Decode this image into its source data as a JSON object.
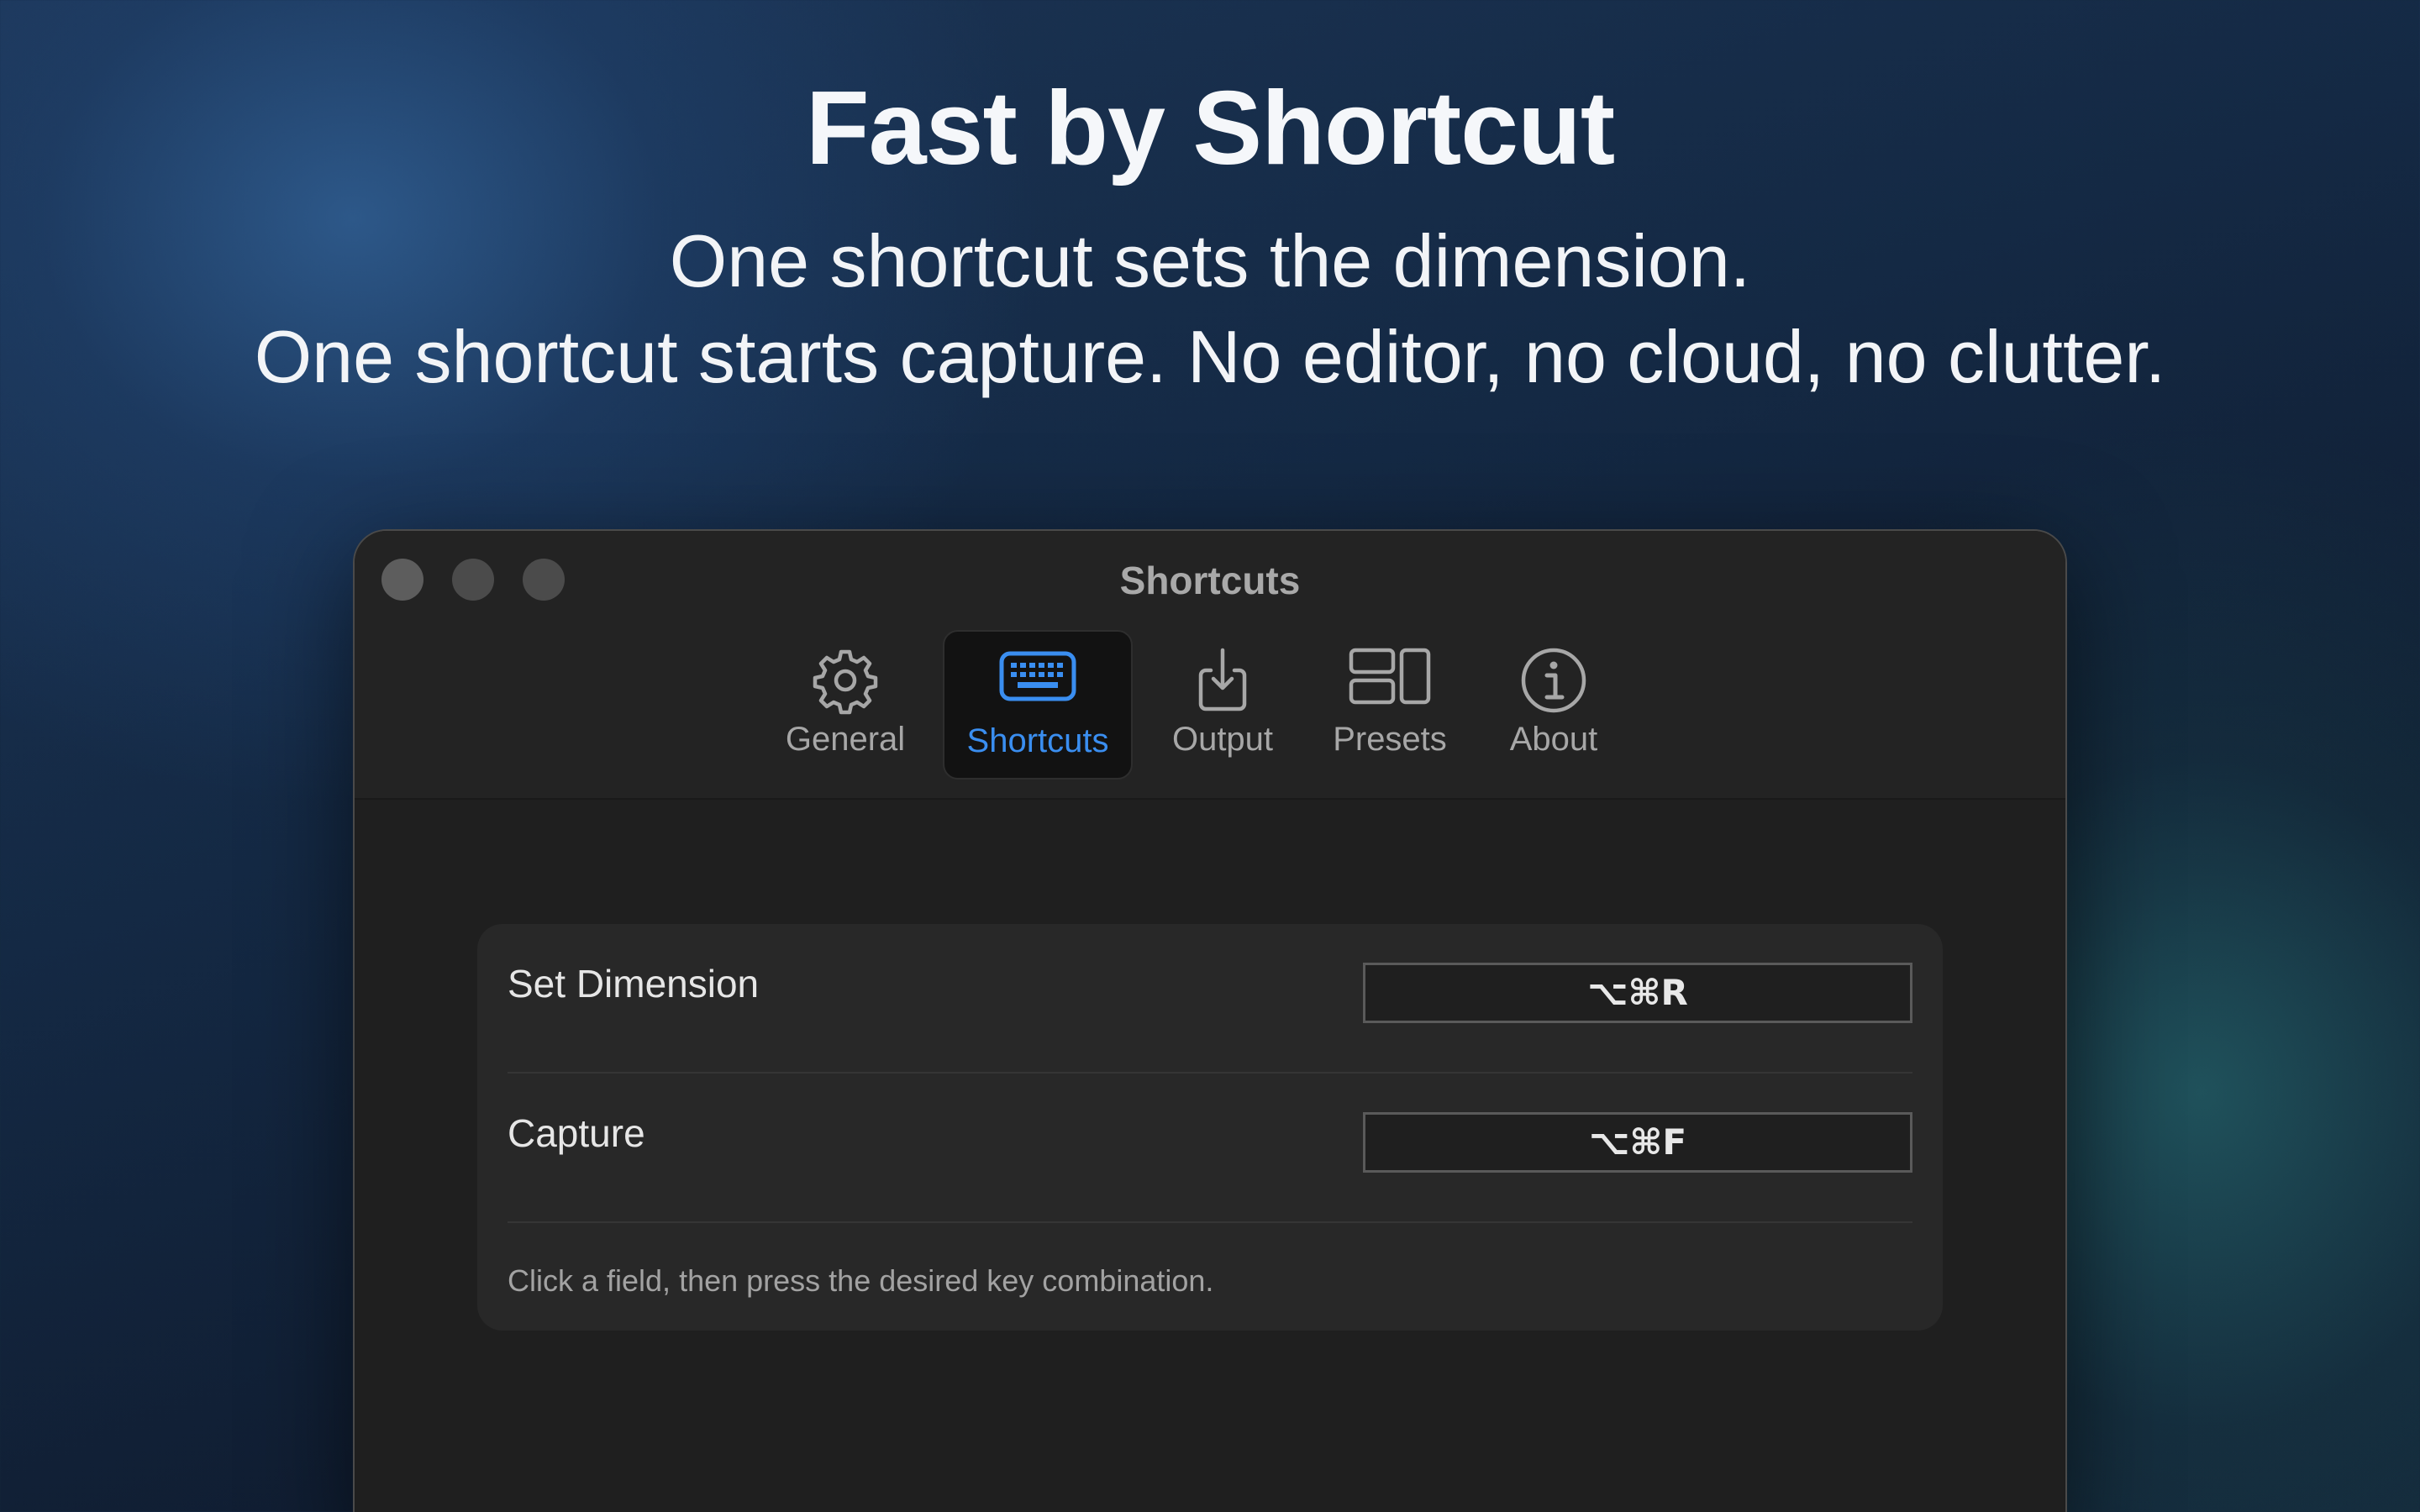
{
  "hero": {
    "title": "Fast by Shortcut",
    "subtitle_line1": "One shortcut sets the dimension.",
    "subtitle_line2": "One shortcut starts capture. No editor, no cloud, no clutter."
  },
  "window": {
    "title": "Shortcuts",
    "traffic_lights": [
      "close",
      "minimize",
      "zoom"
    ]
  },
  "toolbar": {
    "tabs": [
      {
        "label": "General",
        "icon": "gear-icon",
        "active": false
      },
      {
        "label": "Shortcuts",
        "icon": "keyboard-icon",
        "active": true
      },
      {
        "label": "Output",
        "icon": "download-tray-icon",
        "active": false
      },
      {
        "label": "Presets",
        "icon": "layout-grid-icon",
        "active": false
      },
      {
        "label": "About",
        "icon": "info-circle-icon",
        "active": false
      }
    ]
  },
  "shortcuts": {
    "rows": [
      {
        "label": "Set Dimension",
        "value": "⌥⌘R"
      },
      {
        "label": "Capture",
        "value": "⌥⌘F"
      }
    ],
    "hint": "Click a field, then press the desired key combination."
  },
  "colors": {
    "accent": "#3a8ef0",
    "window_bg": "#1f1f1f",
    "panel_bg": "#282828"
  }
}
